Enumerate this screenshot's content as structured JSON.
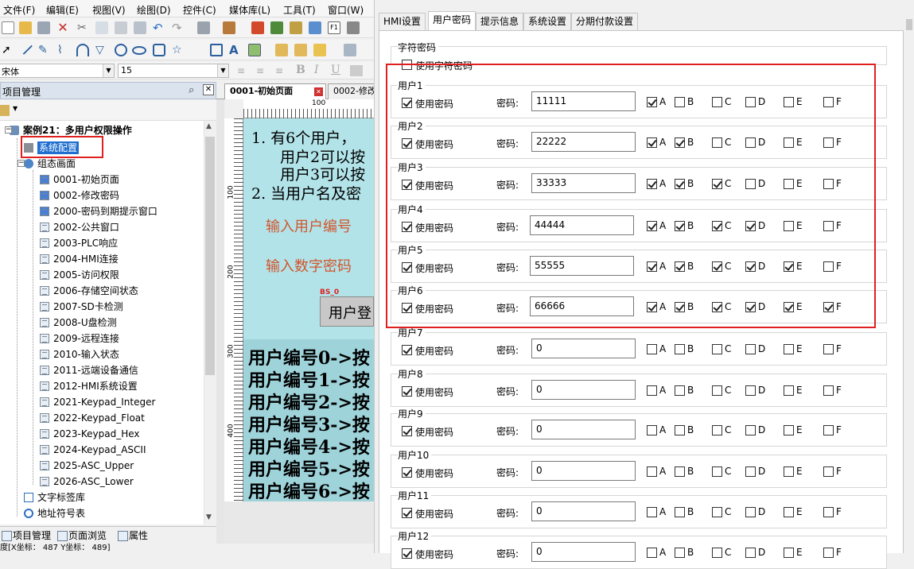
{
  "menu": [
    "文件(F)",
    "编辑(E)",
    "视图(V)",
    "绘图(D)",
    "控件(C)",
    "媒体库(L)",
    "工具(T)",
    "窗口(W)"
  ],
  "font_bar": {
    "font": "宋体",
    "size": "15"
  },
  "project_panel": {
    "title": "项目管理",
    "root": "案例21：多用户权限操作",
    "system_config": "系统配置",
    "screens_folder": "组态画面",
    "screens": [
      "0001-初始页面",
      "0002-修改密码",
      "2000-密码到期提示窗口",
      "2002-公共窗口",
      "2003-PLC响应",
      "2004-HMI连接",
      "2005-访问权限",
      "2006-存储空间状态",
      "2007-SD卡检测",
      "2008-U盘检测",
      "2009-远程连接",
      "2010-输入状态",
      "2011-远端设备通信",
      "2012-HMI系统设置",
      "2021-Keypad_Integer",
      "2022-Keypad_Float",
      "2023-Keypad_Hex",
      "2024-Keypad_ASCII",
      "2025-ASC_Upper",
      "2026-ASC_Lower"
    ],
    "text_tags": "文字标签库",
    "address_table": "地址符号表"
  },
  "bottom_tabs": [
    "项目管理",
    "页面浏览",
    "属性"
  ],
  "status": "度[X坐标： 487  Y坐标： 489]",
  "editor": {
    "tabs": [
      "0001-初始页面",
      "0002-修改"
    ],
    "ruler_label": "100",
    "vruler_labels": [
      "100",
      "200",
      "300",
      "400"
    ],
    "lines": [
      "1. 有6个用户，",
      "用户2可以按",
      "用户3可以按",
      "2. 当用户名及密"
    ],
    "input_user": "输入用户编号",
    "input_pwd": "输入数字密码",
    "bs_tag": "BS_0",
    "login_btn": "用户登",
    "user_lines": [
      "用户编号0->按",
      "用户编号1->按",
      "用户编号2->按",
      "用户编号3->按",
      "用户编号4->按",
      "用户编号5->按",
      "用户编号6->按"
    ]
  },
  "dialog": {
    "tabs": [
      "HMI设置",
      "用户密码",
      "提示信息",
      "系统设置",
      "分期付款设置"
    ],
    "active_tab": "用户密码",
    "char_pwd_group": "字符密码",
    "use_char_pwd": "使用字符密码",
    "use_pwd_label": "使用密码",
    "pwd_label": "密码:",
    "level_labels": [
      "A",
      "B",
      "C",
      "D",
      "E",
      "F"
    ],
    "users": [
      {
        "name": "用户1",
        "use": true,
        "pwd": "11111",
        "levels": [
          true,
          false,
          false,
          false,
          false,
          false
        ]
      },
      {
        "name": "用户2",
        "use": true,
        "pwd": "22222",
        "levels": [
          true,
          true,
          false,
          false,
          false,
          false
        ]
      },
      {
        "name": "用户3",
        "use": true,
        "pwd": "33333",
        "levels": [
          true,
          true,
          true,
          false,
          false,
          false
        ]
      },
      {
        "name": "用户4",
        "use": true,
        "pwd": "44444",
        "levels": [
          true,
          true,
          true,
          true,
          false,
          false
        ]
      },
      {
        "name": "用户5",
        "use": true,
        "pwd": "55555",
        "levels": [
          true,
          true,
          true,
          true,
          true,
          false
        ]
      },
      {
        "name": "用户6",
        "use": true,
        "pwd": "66666",
        "levels": [
          true,
          true,
          true,
          true,
          true,
          true
        ]
      },
      {
        "name": "用户7",
        "use": true,
        "pwd": "0",
        "levels": [
          false,
          false,
          false,
          false,
          false,
          false
        ]
      },
      {
        "name": "用户8",
        "use": true,
        "pwd": "0",
        "levels": [
          false,
          false,
          false,
          false,
          false,
          false
        ]
      },
      {
        "name": "用户9",
        "use": true,
        "pwd": "0",
        "levels": [
          false,
          false,
          false,
          false,
          false,
          false
        ]
      },
      {
        "name": "用户10",
        "use": true,
        "pwd": "0",
        "levels": [
          false,
          false,
          false,
          false,
          false,
          false
        ]
      },
      {
        "name": "用户11",
        "use": true,
        "pwd": "0",
        "levels": [
          false,
          false,
          false,
          false,
          false,
          false
        ]
      },
      {
        "name": "用户12",
        "use": true,
        "pwd": "0",
        "levels": [
          false,
          false,
          false,
          false,
          false,
          false
        ]
      }
    ]
  },
  "colors": {
    "highlight_red": "#e02020",
    "canvas_bg": "#b2e3e9",
    "selection_blue": "#1f6fd0",
    "canvas_text": "#d2552b"
  }
}
